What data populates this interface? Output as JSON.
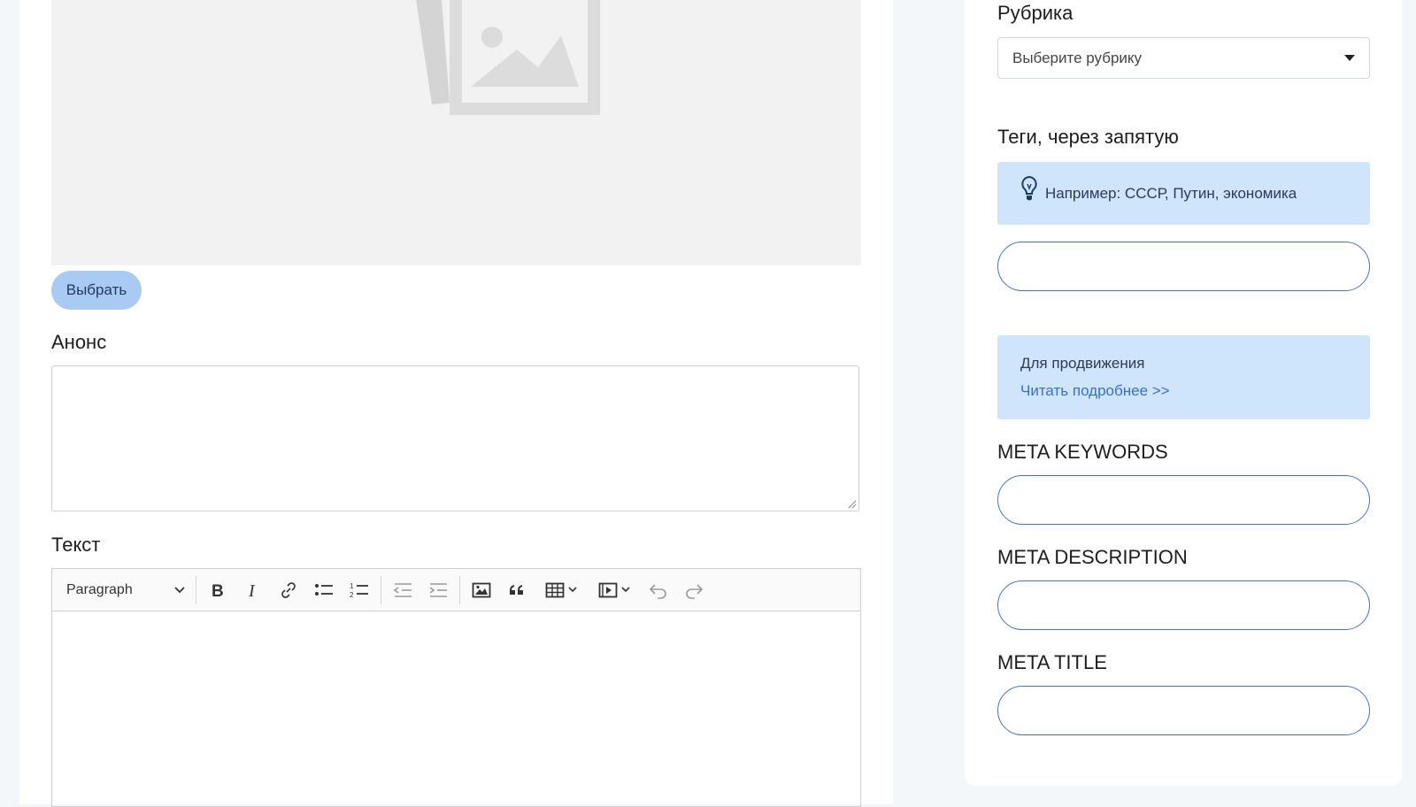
{
  "image": {
    "choose_label": "Выбрать"
  },
  "announce": {
    "label": "Анонс",
    "value": ""
  },
  "text_editor": {
    "label": "Текст",
    "paragraph_label": "Paragraph",
    "tools": [
      "bold-icon",
      "italic-icon",
      "link-icon",
      "bulleted-list-icon",
      "numbered-list-icon",
      "outdent-icon",
      "indent-icon",
      "insert-image-icon",
      "block-quote-icon",
      "table-icon",
      "media-embed-icon",
      "undo-icon",
      "redo-icon"
    ]
  },
  "rubric": {
    "label": "Рубрика",
    "selected": "Выберите рубрику"
  },
  "tags": {
    "label": "Теги, через запятую",
    "hint": "Например: СССР, Путин, экономика",
    "value": ""
  },
  "promo": {
    "text": "Для продвижения",
    "link": "Читать подробнее >>"
  },
  "meta_keywords": {
    "label": "META KEYWORDS",
    "value": ""
  },
  "meta_description": {
    "label": "META DESCRIPTION",
    "value": ""
  },
  "meta_title": {
    "label": "META TITLE",
    "value": ""
  },
  "colors": {
    "accent": "#4a73b6",
    "info_bg": "#cfe5fb",
    "button_bg": "#a9cbf3",
    "link": "#3a6fd0"
  }
}
